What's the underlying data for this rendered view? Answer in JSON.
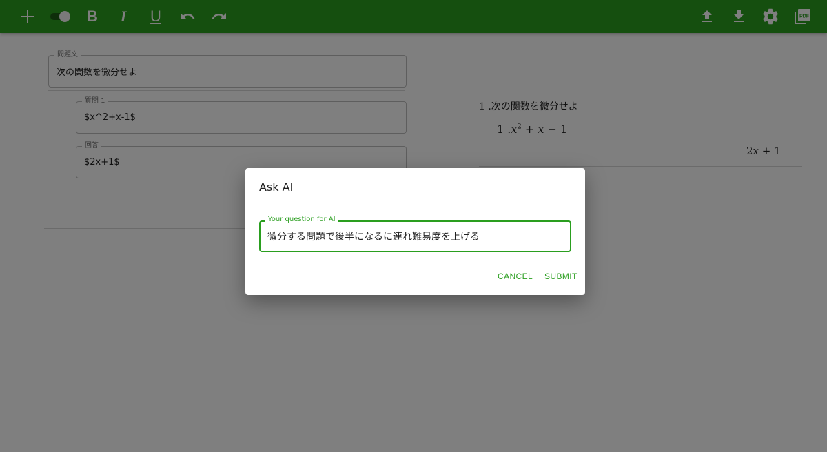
{
  "colors": {
    "brand": "#2a9e1f",
    "overlay": "rgba(0,0,0,0.5)"
  },
  "toolbar": {
    "left_icons": [
      "add-icon",
      "toggle-switch",
      "bold-icon",
      "italic-icon",
      "underline-icon",
      "undo-icon",
      "redo-icon"
    ],
    "right_icons": [
      "upload-icon",
      "download-icon",
      "settings-icon",
      "pdf-icon"
    ],
    "bold_label": "B",
    "italic_label": "I",
    "underline_label": "U",
    "pdf_label": "PDF"
  },
  "editor": {
    "problem": {
      "label": "問題文",
      "value": "次の関数を微分せよ"
    },
    "question1": {
      "label": "質問 1",
      "value": "$x^2+x-1$"
    },
    "answer": {
      "label": "回答",
      "value": "$2x+1$"
    }
  },
  "preview": {
    "question": "1 .次の関数を微分せよ",
    "sub_number": "1 .",
    "sub_x": "x",
    "sub_exp": "2",
    "sub_rest": " + ",
    "sub_x2": "x",
    "sub_tail": " − 1",
    "answer_coef": "2",
    "answer_x": "x",
    "answer_tail": " + 1"
  },
  "dialog": {
    "title": "Ask AI",
    "input_label": "Your question for AI",
    "input_value": "微分する問題で後半になるに連れ難易度を上げる",
    "cancel_label": "CANCEL",
    "submit_label": "SUBMIT"
  }
}
